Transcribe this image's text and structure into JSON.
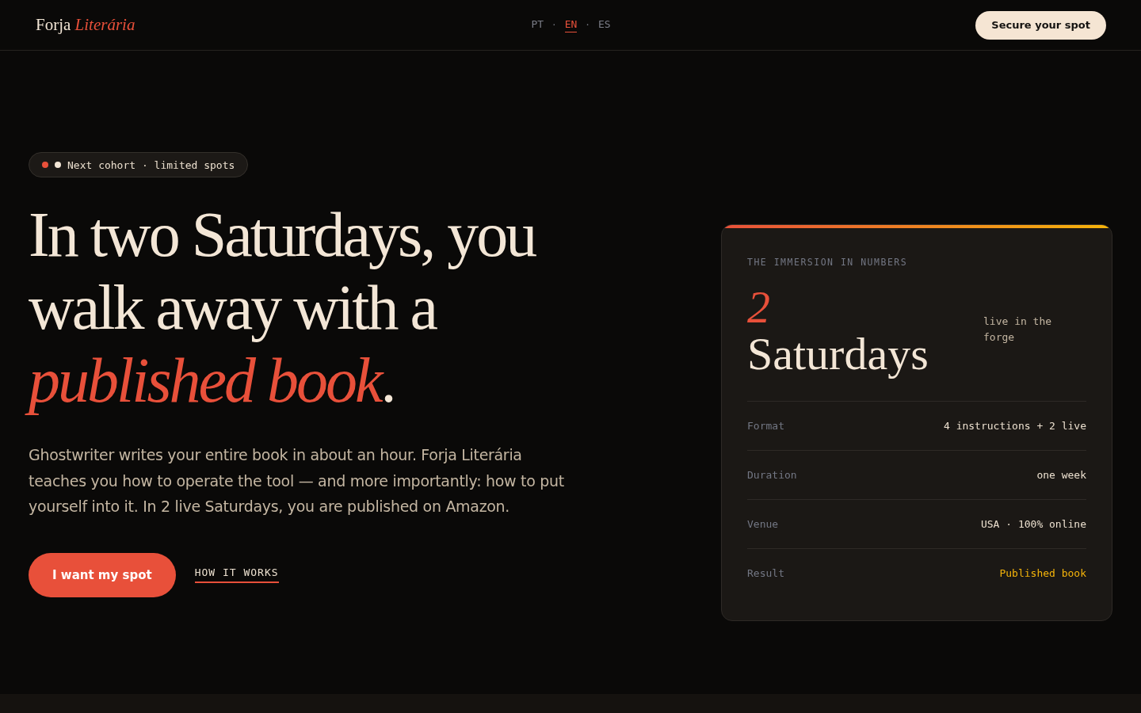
{
  "header": {
    "logo": {
      "main": "Forja",
      "accent": "Literária"
    },
    "languages": [
      {
        "code": "PT",
        "selected": false
      },
      {
        "code": "EN",
        "selected": true
      },
      {
        "code": "ES",
        "selected": false
      }
    ],
    "separator": "·",
    "cta": "Secure your spot"
  },
  "hero": {
    "badge": {
      "dots": [
        {
          "color": "#e8503a"
        },
        {
          "color": "#f3e6d6"
        }
      ],
      "text": "Next cohort · limited spots"
    },
    "headline": {
      "lead": "In two Saturdays, you walk away with a",
      "emphasis": "published book",
      "end": "."
    },
    "description": "Ghostwriter writes your entire book in about an hour. Forja Literária teaches you how to operate the tool — and more importantly: how to put yourself into it. In 2 live Saturdays, you are published on Amazon.",
    "primary_button": "I want my spot",
    "secondary_link": "HOW IT WORKS"
  },
  "card": {
    "eyebrow": "THE IMMERSION IN NUMBERS",
    "number": "2",
    "unit": "Saturdays",
    "note": "live in the forge",
    "rows": [
      {
        "label": "Format",
        "value": "4 instructions + 2 live",
        "highlight": false
      },
      {
        "label": "Duration",
        "value": "one week",
        "highlight": false
      },
      {
        "label": "Venue",
        "value": "USA · 100% online",
        "highlight": false
      },
      {
        "label": "Result",
        "value": "Published book",
        "highlight": true
      }
    ]
  }
}
